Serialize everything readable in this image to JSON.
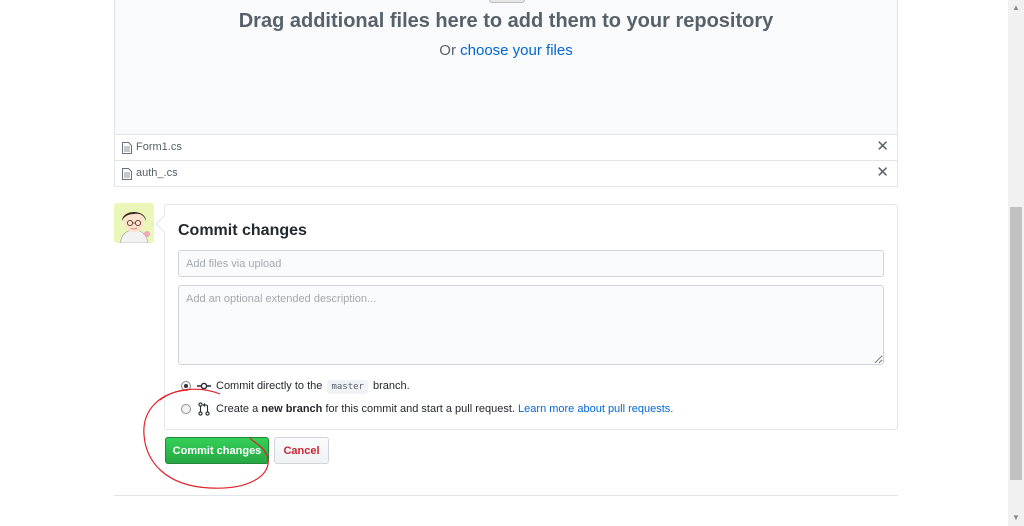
{
  "dropzone": {
    "title": "Drag additional files here to add them to your repository",
    "sub_prefix": "Or",
    "sub_link": "choose your files"
  },
  "files": [
    {
      "name": "Form1.cs",
      "remove_icon": "x-icon"
    },
    {
      "name": "auth_.cs",
      "remove_icon": "x-icon"
    }
  ],
  "commit": {
    "title": "Commit changes",
    "summary_placeholder": "Add files via upload",
    "description_placeholder": "Add an optional extended description...",
    "option_direct": {
      "checked": true,
      "prefix": "Commit directly to the",
      "branch": "master",
      "suffix": "branch."
    },
    "option_new_branch": {
      "checked": false,
      "prefix": "Create a",
      "bold": "new branch",
      "suffix": "for this commit and start a pull request.",
      "link": "Learn more about pull requests."
    },
    "commit_button": "Commit changes",
    "cancel_button": "Cancel"
  },
  "colors": {
    "link": "#0366d6",
    "commit_green": "#28a745",
    "cancel_red": "#cb2431",
    "annotation_red": "#e0202a"
  }
}
